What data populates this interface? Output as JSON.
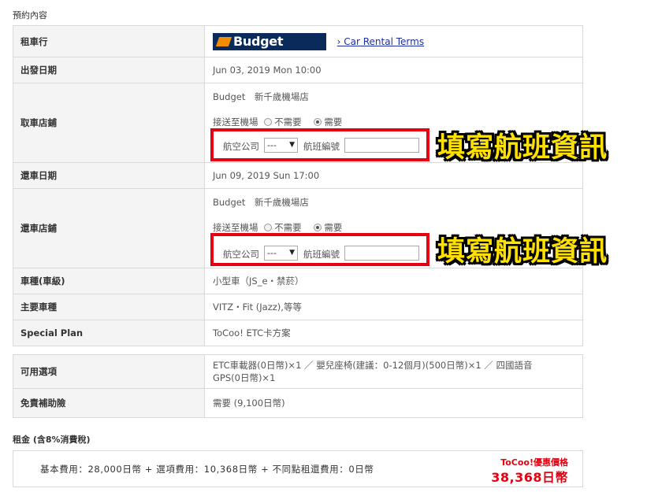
{
  "reservation": {
    "section_title": "預約內容",
    "rows": {
      "rental_company": {
        "label": "租車行",
        "logo_text": "Budget",
        "terms_link": "› Car Rental Terms"
      },
      "depart_date": {
        "label": "出發日期",
        "value": "Jun 03, 2019 Mon 10:00"
      },
      "pickup_store": {
        "label": "取車店鋪",
        "store": "Budget　新千歲機場店",
        "shuttle_label": "接送至機場",
        "option_no": "不需要",
        "option_yes": "需要",
        "airline_label": "航空公司",
        "airline_value": "---",
        "flight_label": "航班編號",
        "flight_value": ""
      },
      "return_date": {
        "label": "還車日期",
        "value": "Jun 09, 2019 Sun 17:00"
      },
      "return_store": {
        "label": "還車店鋪",
        "store": "Budget　新千歲機場店",
        "shuttle_label": "接送至機場",
        "option_no": "不需要",
        "option_yes": "需要",
        "airline_label": "航空公司",
        "airline_value": "---",
        "flight_label": "航班編號",
        "flight_value": ""
      },
      "car_class": {
        "label": "車種(車級)",
        "value": "小型車（JS_e・禁菸）"
      },
      "main_cars": {
        "label": "主要車種",
        "value": "VITZ・Fit (Jazz),等等"
      },
      "special_plan": {
        "label": "Special Plan",
        "value": "ToCoo! ETC卡方案"
      }
    }
  },
  "options": {
    "available": {
      "label": "可用選項",
      "line1": "ETC車載器(0日幣)×1 ／ 嬰兒座椅(建議：0-12個月)(500日幣)×1 ／ 四國語音",
      "line2": "GPS(0日幣)×1"
    },
    "insurance": {
      "label": "免責補助險",
      "value": "需要 (9,100日幣)"
    }
  },
  "annotations": {
    "callout_text": "填寫航班資訊"
  },
  "pricing": {
    "section_title": "租金 (含8%消費稅)",
    "formula": "基本費用：28,000日幣 + 選項費用：10,368日幣 + 不同點租還費用：0日幣",
    "promo_label": "ToCoo!優惠價格",
    "promo_price": "38,368日幣"
  },
  "colors": {
    "highlight_border": "#e60012",
    "callout_fill": "#ffe100",
    "promo_text": "#e60012",
    "link": "#1a2ea8"
  }
}
